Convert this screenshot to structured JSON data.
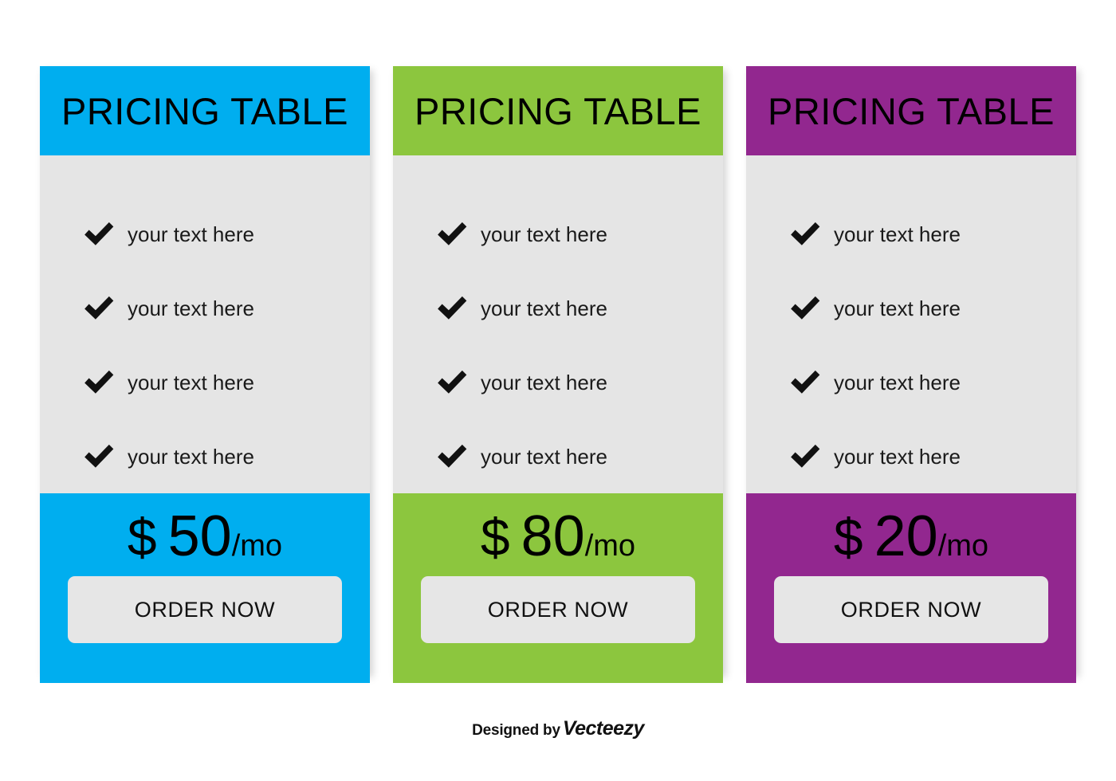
{
  "page": {
    "background_color": "#ffffff",
    "body_panel_color": "#e5e5e5",
    "button_color": "#e6e6e6"
  },
  "cards": [
    {
      "id": "card-blue",
      "title": "PRICING TABLE",
      "accent_color": "#00aeef",
      "features": [
        {
          "icon": "check-icon",
          "label": "your text here"
        },
        {
          "icon": "check-icon",
          "label": "your text here"
        },
        {
          "icon": "check-icon",
          "label": "your text here"
        },
        {
          "icon": "check-icon",
          "label": "your text here"
        }
      ],
      "price": {
        "currency": "$",
        "amount": "50",
        "period": "/mo"
      },
      "order_label": "ORDER NOW"
    },
    {
      "id": "card-green",
      "title": "PRICING TABLE",
      "accent_color": "#8cc63e",
      "features": [
        {
          "icon": "check-icon",
          "label": "your text here"
        },
        {
          "icon": "check-icon",
          "label": "your text here"
        },
        {
          "icon": "check-icon",
          "label": "your text here"
        },
        {
          "icon": "check-icon",
          "label": "your text here"
        }
      ],
      "price": {
        "currency": "$",
        "amount": "80",
        "period": "/mo"
      },
      "order_label": "ORDER NOW"
    },
    {
      "id": "card-purple",
      "title": "PRICING TABLE",
      "accent_color": "#92278f",
      "features": [
        {
          "icon": "check-icon",
          "label": "your text here"
        },
        {
          "icon": "check-icon",
          "label": "your text here"
        },
        {
          "icon": "check-icon",
          "label": "your text here"
        },
        {
          "icon": "check-icon",
          "label": "your text here"
        }
      ],
      "price": {
        "currency": "$",
        "amount": "20",
        "period": "/mo"
      },
      "order_label": "ORDER NOW"
    }
  ],
  "attribution": {
    "prefix": "Designed by",
    "brand": "Vecteezy"
  }
}
